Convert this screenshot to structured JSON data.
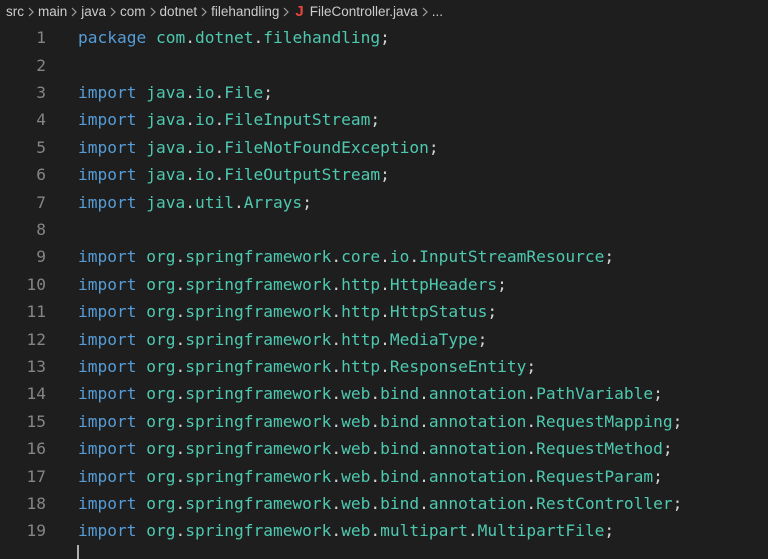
{
  "breadcrumb": {
    "items": [
      "src",
      "main",
      "java",
      "com",
      "dotnet",
      "filehandling"
    ],
    "file_icon": "J",
    "file": "FileController.java",
    "more": "..."
  },
  "colors": {
    "background": "#1e1e1e",
    "keyword": "#569cd6",
    "package_path": "#4ec9b0",
    "punctuation": "#d4d4d4",
    "line_number": "#858585",
    "java_icon": "#e8453c"
  },
  "lines": [
    {
      "n": "1",
      "kw": "package",
      "path": "com.dotnet.filehandling",
      "end": ";"
    },
    {
      "n": "2",
      "kw": "",
      "path": "",
      "end": ""
    },
    {
      "n": "3",
      "kw": "import",
      "path": "java.io.File",
      "end": ";"
    },
    {
      "n": "4",
      "kw": "import",
      "path": "java.io.FileInputStream",
      "end": ";"
    },
    {
      "n": "5",
      "kw": "import",
      "path": "java.io.FileNotFoundException",
      "end": ";"
    },
    {
      "n": "6",
      "kw": "import",
      "path": "java.io.FileOutputStream",
      "end": ";"
    },
    {
      "n": "7",
      "kw": "import",
      "path": "java.util.Arrays",
      "end": ";"
    },
    {
      "n": "8",
      "kw": "",
      "path": "",
      "end": ""
    },
    {
      "n": "9",
      "kw": "import",
      "path": "org.springframework.core.io.InputStreamResource",
      "end": ";"
    },
    {
      "n": "10",
      "kw": "import",
      "path": "org.springframework.http.HttpHeaders",
      "end": ";"
    },
    {
      "n": "11",
      "kw": "import",
      "path": "org.springframework.http.HttpStatus",
      "end": ";"
    },
    {
      "n": "12",
      "kw": "import",
      "path": "org.springframework.http.MediaType",
      "end": ";"
    },
    {
      "n": "13",
      "kw": "import",
      "path": "org.springframework.http.ResponseEntity",
      "end": ";"
    },
    {
      "n": "14",
      "kw": "import",
      "path": "org.springframework.web.bind.annotation.PathVariable",
      "end": ";"
    },
    {
      "n": "15",
      "kw": "import",
      "path": "org.springframework.web.bind.annotation.RequestMapping",
      "end": ";"
    },
    {
      "n": "16",
      "kw": "import",
      "path": "org.springframework.web.bind.annotation.RequestMethod",
      "end": ";"
    },
    {
      "n": "17",
      "kw": "import",
      "path": "org.springframework.web.bind.annotation.RequestParam",
      "end": ";"
    },
    {
      "n": "18",
      "kw": "import",
      "path": "org.springframework.web.bind.annotation.RestController",
      "end": ";"
    },
    {
      "n": "19",
      "kw": "import",
      "path": "org.springframework.web.multipart.MultipartFile",
      "end": ";"
    }
  ]
}
